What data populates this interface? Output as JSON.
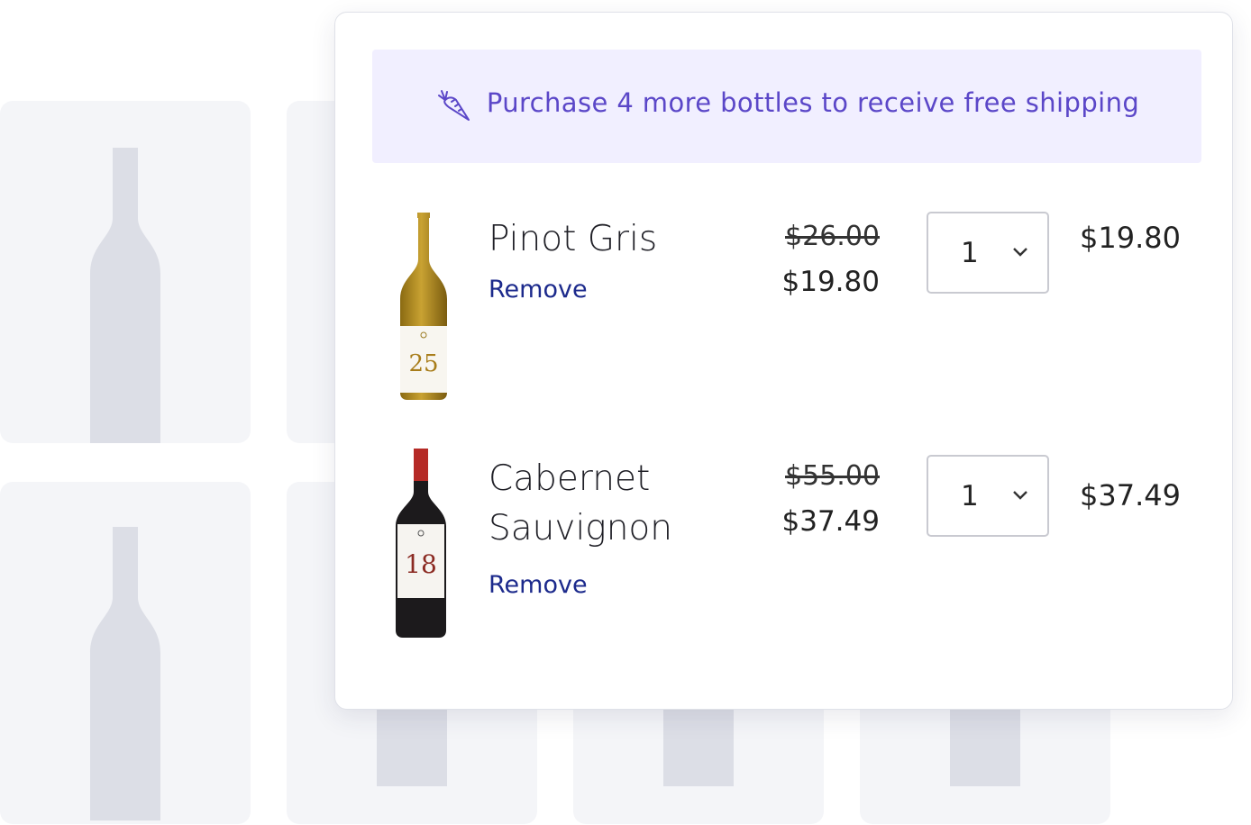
{
  "banner": {
    "icon": "carrot-icon",
    "text": "Purchase 4 more bottles to receive free shipping",
    "color": "#5b47c8",
    "background": "#f1efff"
  },
  "cart_items": [
    {
      "name": "Pinot Gris",
      "remove_label": "Remove",
      "original_price": "$26.00",
      "sale_price": "$19.80",
      "quantity": "1",
      "line_total": "$19.80",
      "label_number": "25"
    },
    {
      "name": "Cabernet Sauvignon",
      "remove_label": "Remove",
      "original_price": "$55.00",
      "sale_price": "$37.49",
      "quantity": "1",
      "line_total": "$37.49",
      "label_number": "18"
    }
  ],
  "colors": {
    "remove_link": "#1c2a8c",
    "placeholder_card": "#f4f5f8",
    "placeholder_bottle": "#dcdee6"
  }
}
